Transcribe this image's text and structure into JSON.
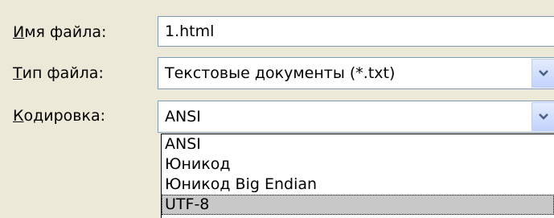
{
  "fields": {
    "filename": {
      "label_mnemonic": "И",
      "label_rest": "мя файла:",
      "value": "1.html"
    },
    "filetype": {
      "label_mnemonic": "Т",
      "label_rest": "ип файла:",
      "value": "Текстовые документы (*.txt)"
    },
    "encoding": {
      "label_mnemonic": "К",
      "label_rest": "одировка:",
      "value": "ANSI"
    }
  },
  "encoding_options": [
    "ANSI",
    "Юникод",
    "Юникод Big Endian",
    "UTF-8"
  ],
  "highlighted_option": "UTF-8",
  "icons": {
    "dropdown": "chevron-down-icon"
  }
}
